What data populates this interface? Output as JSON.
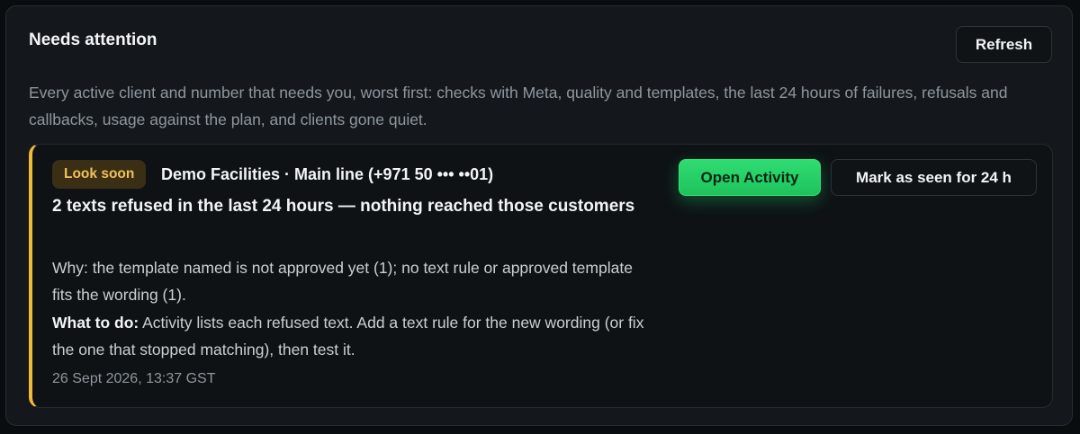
{
  "panel": {
    "title": "Needs attention",
    "refresh_label": "Refresh",
    "description": "Every active client and number that needs you, worst first: checks with Meta, quality and templates, the last 24 hours of failures, refusals and callbacks, usage against the plan, and clients gone quiet."
  },
  "alert": {
    "severity_label": "Look soon",
    "client_line": "Demo Facilities · Main line (+971 50 ••• ••01)",
    "headline": "2 texts refused in the last 24 hours — nothing reached those customers",
    "why": "Why: the template named is not approved yet (1); no text rule or approved template fits the wording (1).",
    "todo_label": "What to do:",
    "todo_text": " Activity lists each refused text. Add a text rule for the new wording (or fix the one that stopped matching), then test it.",
    "timestamp": "26 Sept 2026, 13:37 GST",
    "primary_action": "Open Activity",
    "secondary_action": "Mark as seen for 24 h"
  },
  "colors": {
    "accent_warning": "#f0b93a",
    "accent_primary": "#22c55e",
    "background": "#14181c"
  }
}
